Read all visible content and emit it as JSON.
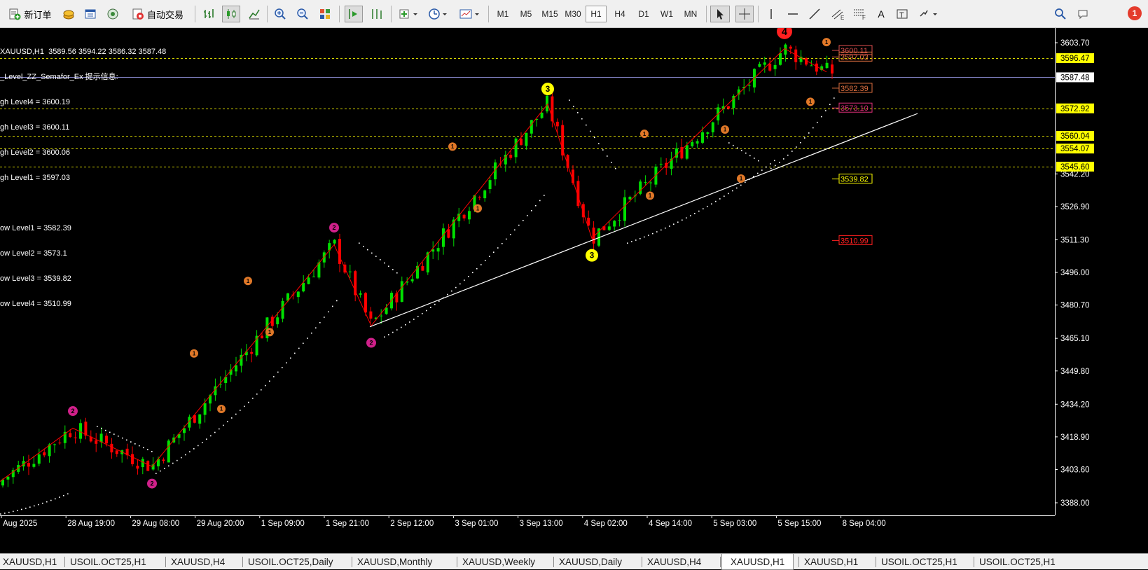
{
  "toolbar": {
    "new_order": "新订单",
    "auto_trading": "自动交易",
    "timeframes": [
      "M1",
      "M5",
      "M15",
      "M30",
      "H1",
      "H4",
      "D1",
      "W1",
      "MN"
    ],
    "active_timeframe": "H1",
    "notification_count": "1"
  },
  "chart": {
    "header": "XAUUSD,H1  3589.56 3594.22 3586.32 3587.48",
    "indicator_title": "_Level_ZZ_Semafor_Ex 提示信息:",
    "info_lines": [
      "gh Level4 = 3600.19",
      "gh Level3 = 3600.11",
      "gh Level2 = 3600.06",
      "gh Level1 = 3597.03",
      "",
      "ow Level1 = 3582.39",
      "ow Level2 = 3573.1",
      "ow Level3 = 3539.82",
      "ow Level4 = 3510.99"
    ],
    "price_axis": [
      "3603.70",
      "3542.20",
      "3526.90",
      "3511.30",
      "3496.00",
      "3480.70",
      "3465.10",
      "3449.80",
      "3434.20",
      "3418.90",
      "3403.60",
      "3388.00"
    ],
    "highlighted_prices": [
      {
        "label": "3596.47",
        "price": 3596.47,
        "bg": "#ffff00",
        "fg": "#000000"
      },
      {
        "label": "3587.48",
        "price": 3587.48,
        "bg": "#ffffff",
        "fg": "#000000"
      },
      {
        "label": "3572.92",
        "price": 3572.92,
        "bg": "#ffff00",
        "fg": "#000000"
      },
      {
        "label": "3560.04",
        "price": 3560.04,
        "bg": "#ffff00",
        "fg": "#000000"
      },
      {
        "label": "3554.07",
        "price": 3554.07,
        "bg": "#ffff00",
        "fg": "#000000"
      },
      {
        "label": "3545.60",
        "price": 3545.6,
        "bg": "#ffff00",
        "fg": "#000000"
      }
    ],
    "level_labels": [
      {
        "label": "3600.11",
        "price": 3600.11,
        "color": "#e05050"
      },
      {
        "label": "3597.03",
        "price": 3597.03,
        "color": "#e07040"
      },
      {
        "label": "3582.39",
        "price": 3582.39,
        "color": "#e07040"
      },
      {
        "label": "3573.10",
        "price": 3573.1,
        "color": "#e0307a"
      },
      {
        "label": "3539.82",
        "price": 3539.82,
        "color": "#ffff00"
      },
      {
        "label": "3510.99",
        "price": 3510.99,
        "color": "#ff2020"
      }
    ],
    "time_axis": [
      "Aug 2025",
      "28 Aug 19:00",
      "29 Aug 08:00",
      "29 Aug 20:00",
      "1 Sep 09:00",
      "1 Sep 21:00",
      "2 Sep 12:00",
      "3 Sep 01:00",
      "3 Sep 13:00",
      "4 Sep 02:00",
      "4 Sep 14:00",
      "5 Sep 03:00",
      "5 Sep 15:00",
      "8 Sep 04:00"
    ],
    "semafor_markers": [
      {
        "label": "4",
        "color": "#ff2020"
      },
      {
        "label": "3",
        "color": "#ffff00"
      },
      {
        "label": "2",
        "color": "#d0208a"
      },
      {
        "label": "1",
        "color": "#e07828"
      }
    ]
  },
  "tabs": [
    "XAUUSD,H1",
    "USOIL.OCT25,H1",
    "XAUUSD,H4",
    "USOIL.OCT25,Daily",
    "XAUUSD,Monthly",
    "XAUUSD,Weekly",
    "XAUUSD,Daily",
    "XAUUSD,H4",
    "XAUUSD,H1",
    "XAUUSD,H1",
    "USOIL.OCT25,H1",
    "USOIL.OCT25,H1"
  ],
  "active_tab_index": 8,
  "colors": {
    "up": "#00e000",
    "down": "#ff0000",
    "zigzag": "#ff0000",
    "trendline": "#ffffff",
    "sar": "#ffffff"
  }
}
